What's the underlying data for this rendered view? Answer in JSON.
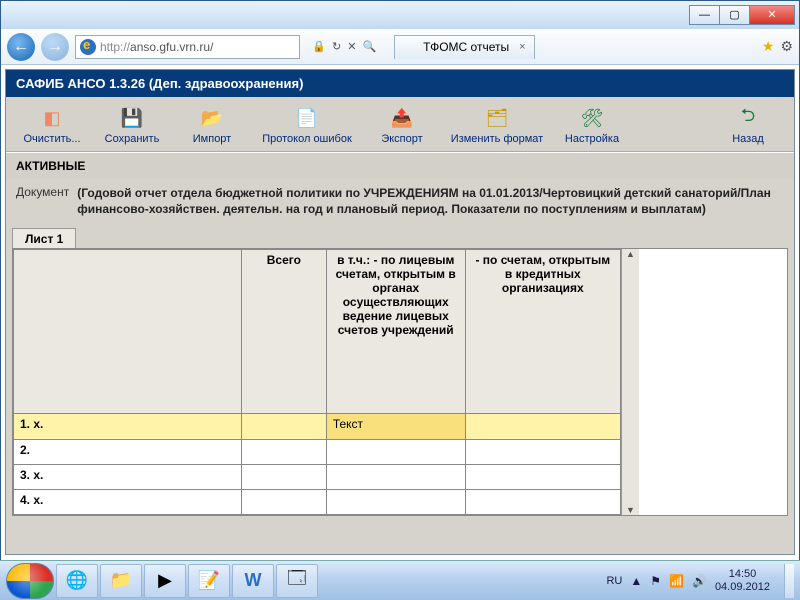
{
  "browser": {
    "url_proto": "http://",
    "url_host": "anso.gfu.vrn.ru/",
    "tab_title": "ТФОМС отчеты",
    "refresh_glyph": "↻",
    "stop_glyph": "✕",
    "search_glyph": "🔍",
    "lock_glyph": "🔒",
    "win_buttons": {
      "min": "—",
      "max": "▢",
      "close": "✕"
    }
  },
  "app": {
    "title": "САФИБ АНСО 1.3.26 (Деп. здравоохранения)",
    "toolbar": {
      "clear": "Очистить...",
      "save": "Сохранить",
      "import": "Импорт",
      "errors": "Протокол ошибок",
      "export": "Экспорт",
      "format": "Изменить формат",
      "settings": "Настройка",
      "back": "Назад"
    },
    "section": "АКТИВНЫЕ",
    "doc_label": "Документ",
    "doc_text": "(Годовой отчет отдела бюджетной политики по УЧРЕЖДЕНИЯМ на 01.01.2013/Чертовицкий детский санаторий/План финансово-хозяйствен. деятельн. на год и плановый период. Показатели по поступлениям и выплатам)",
    "sheet_tab": "Лист 1",
    "columns": {
      "c0": "",
      "c1": "Всего",
      "c2": "в т.ч.: - по лицевым счетам, открытым в органах осуществляющих ведение лицевых счетов учреждений",
      "c3": "- по счетам, открытым в кредитных организациях"
    },
    "rows": [
      {
        "label": "1. x.",
        "c1": "",
        "c2": "Текст",
        "c3": "",
        "selected": true
      },
      {
        "label": "2.",
        "c1": "",
        "c2": "",
        "c3": "",
        "selected": false
      },
      {
        "label": "3. x.",
        "c1": "",
        "c2": "",
        "c3": "",
        "selected": false
      },
      {
        "label": "4. x.",
        "c1": "",
        "c2": "",
        "c3": "",
        "selected": false
      }
    ]
  },
  "taskbar": {
    "lang": "RU",
    "time": "14:50",
    "date": "04.09.2012",
    "flag_glyph": "⚑",
    "net_glyph": "📶",
    "vol_glyph": "🔊",
    "up_glyph": "▲"
  }
}
